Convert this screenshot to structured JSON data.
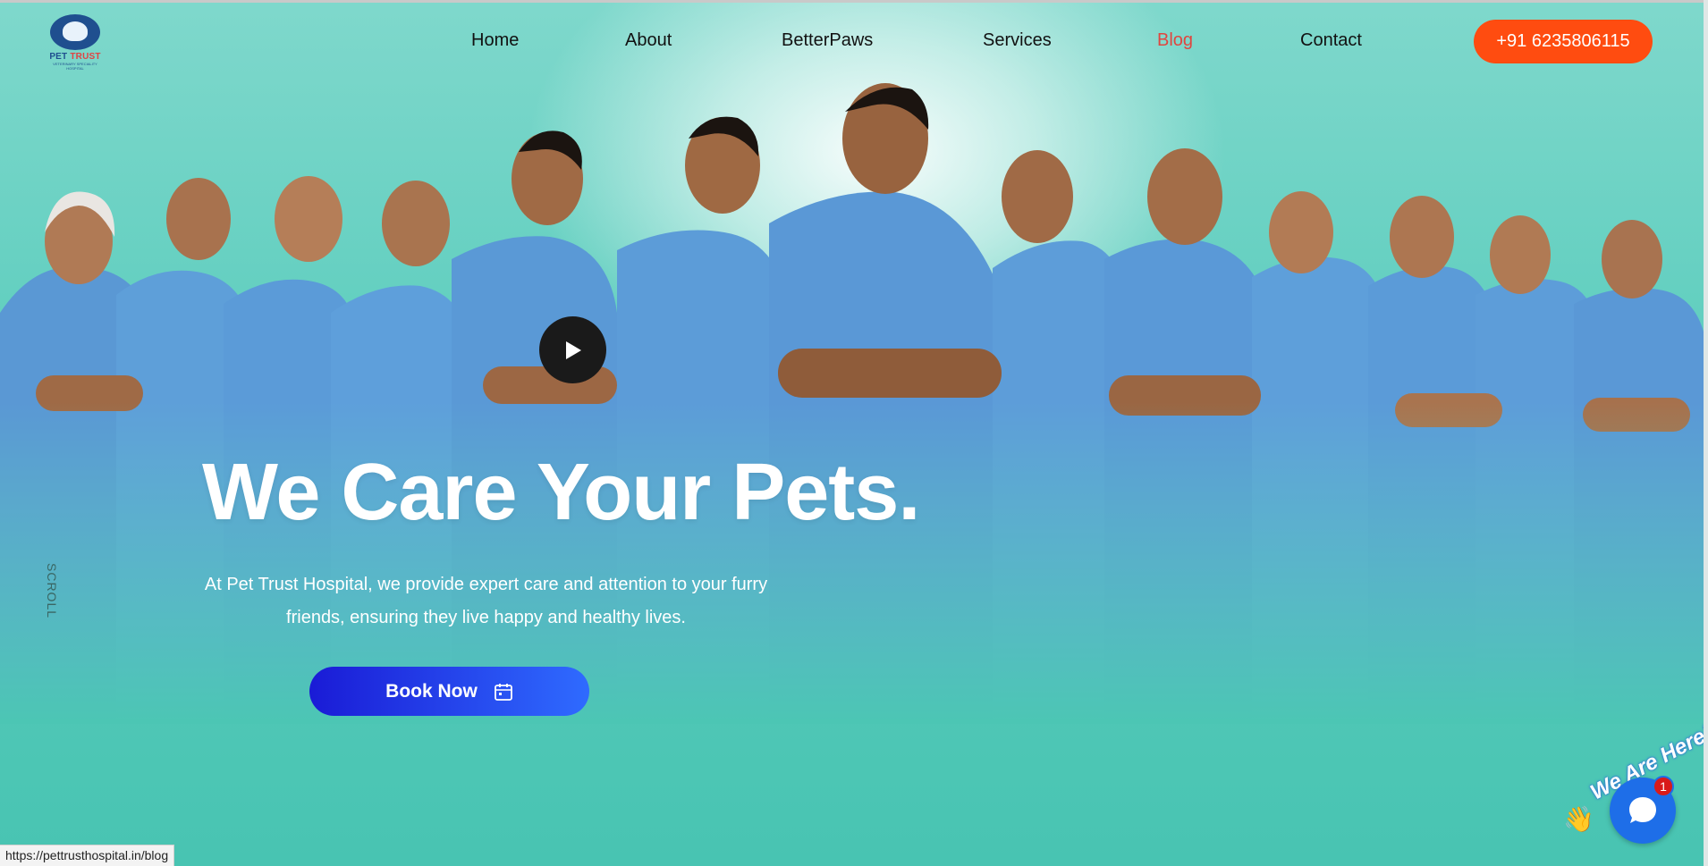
{
  "header": {
    "logo": {
      "name": "PET TRUST",
      "brand_main": "PET ",
      "brand_accent": "TRUST",
      "tagline": "VETERINARY SPECIALITY HOSPITAL"
    },
    "nav": [
      {
        "label": "Home",
        "active": false
      },
      {
        "label": "About",
        "active": false
      },
      {
        "label": "BetterPaws",
        "active": false
      },
      {
        "label": "Services",
        "active": false
      },
      {
        "label": "Blog",
        "active": true
      },
      {
        "label": "Contact",
        "active": false
      }
    ],
    "phone_label": "+91 6235806115"
  },
  "hero": {
    "headline": "We Care Your Pets.",
    "description": "At Pet Trust Hospital, we provide expert care and attention to your furry friends, ensuring they live happy and healthy lives.",
    "book_label": "Book Now",
    "scroll_label": "SCROLL"
  },
  "chat": {
    "label": "We Are Here!",
    "badge_count": "1"
  },
  "status_bar": {
    "url": "https://pettrusthospital.in/blog"
  },
  "colors": {
    "accent": "#ff4c10",
    "active_nav": "#e0463f",
    "book_start": "#1a1bd6",
    "book_end": "#2f6bff",
    "hero_bg": "#4fc8b8",
    "scrub_blue": "#5b9bd8"
  },
  "icons": [
    "play-icon",
    "calendar-icon",
    "chat-bubble-icon",
    "waving-hand-icon"
  ]
}
